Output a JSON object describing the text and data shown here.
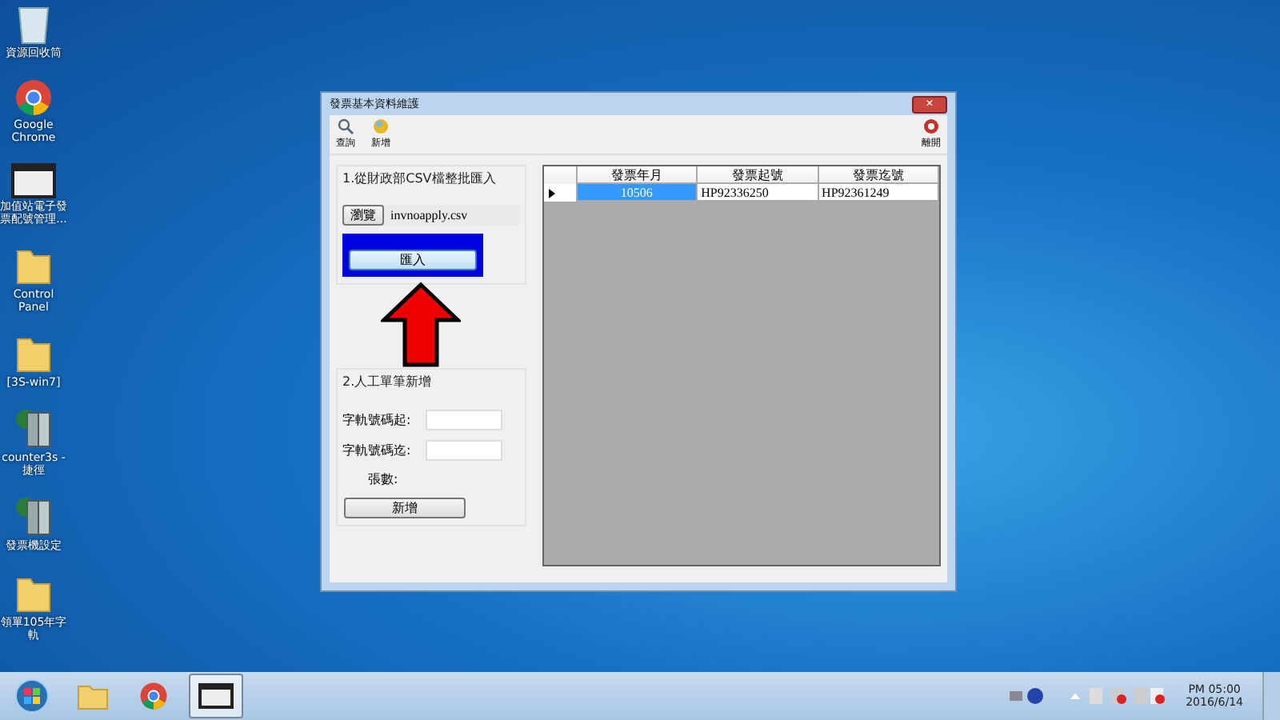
{
  "desktop_icons": [
    {
      "label": "資源回收筒",
      "kind": "bin"
    },
    {
      "label": "Google Chrome",
      "kind": "chrome"
    },
    {
      "label": "加值站電子發票配號管理...",
      "kind": "app"
    },
    {
      "label": "Control Panel",
      "kind": "folder"
    },
    {
      "label": "[3S-win7]",
      "kind": "folder"
    },
    {
      "label": "counter3s - 捷徑",
      "kind": "server"
    },
    {
      "label": "發票機設定",
      "kind": "server"
    },
    {
      "label": "領單105年字軌",
      "kind": "folder"
    }
  ],
  "window": {
    "title": "發票基本資料維護",
    "close": "×"
  },
  "toolbar": [
    {
      "label": "查詢",
      "kind": "search"
    },
    {
      "label": "新增",
      "kind": "add"
    }
  ],
  "exit_button": {
    "label": "離開"
  },
  "import_section": {
    "title": "1.從財政部CSV檔整批匯入",
    "browse": "瀏覽",
    "file": "invnoapply.csv",
    "import": "匯入",
    "highlighted": true
  },
  "manual_section": {
    "title": "2.人工單筆新增",
    "start_label": "字軌號碼起:",
    "end_label": "字軌號碼迄:",
    "count_label": "張數:",
    "add": "新增"
  },
  "table": {
    "columns": [
      "發票年月",
      "發票起號",
      "發票迄號"
    ],
    "rows": [
      {
        "cells": [
          "10506",
          "HP92336250",
          "HP92361249"
        ],
        "selected": true
      }
    ]
  },
  "taskbar": {
    "apps": [
      {
        "kind": "start"
      },
      {
        "kind": "explorer"
      },
      {
        "kind": "chrome"
      },
      {
        "kind": "window",
        "selected": true
      }
    ],
    "time": "PM 05:00",
    "date": "2016/6/14"
  }
}
